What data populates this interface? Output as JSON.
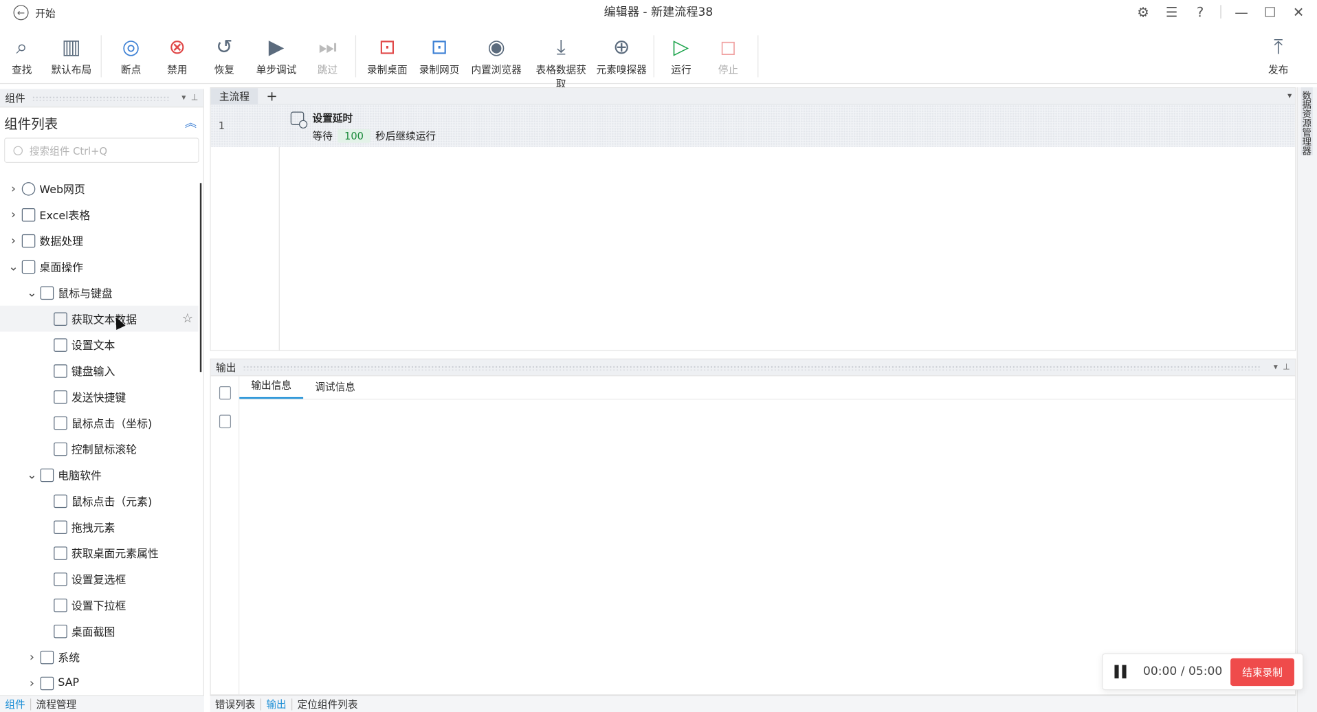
{
  "window": {
    "back_label": "开始",
    "title": "编辑器 - 新建流程38"
  },
  "toolbar": {
    "items": [
      {
        "id": "find",
        "label": "查找",
        "icon": "magnifier-icon",
        "enabled": true
      },
      {
        "id": "layout",
        "label": "默认布局",
        "icon": "layout-icon",
        "enabled": true
      },
      {
        "id": "breakpoint",
        "label": "断点",
        "icon": "breakpoint-icon",
        "enabled": true
      },
      {
        "id": "disable",
        "label": "禁用",
        "icon": "disable-icon",
        "enabled": true
      },
      {
        "id": "restore",
        "label": "恢复",
        "icon": "undo-icon",
        "enabled": true
      },
      {
        "id": "step",
        "label": "单步调试",
        "icon": "step-debug-icon",
        "enabled": true
      },
      {
        "id": "skip",
        "label": "跳过",
        "icon": "skip-icon",
        "enabled": false
      },
      {
        "id": "rec-desktop",
        "label": "录制桌面",
        "icon": "record-desktop-icon",
        "enabled": true
      },
      {
        "id": "rec-web",
        "label": "录制网页",
        "icon": "record-web-icon",
        "enabled": true
      },
      {
        "id": "browser",
        "label": "内置浏览器",
        "icon": "compass-icon",
        "enabled": true
      },
      {
        "id": "table",
        "label": "表格数据获取",
        "icon": "download-table-icon",
        "enabled": true
      },
      {
        "id": "sniffer",
        "label": "元素嗅探器",
        "icon": "target-icon",
        "enabled": true
      },
      {
        "id": "run",
        "label": "运行",
        "icon": "play-icon",
        "enabled": true
      },
      {
        "id": "stop",
        "label": "停止",
        "icon": "stop-icon",
        "enabled": false
      },
      {
        "id": "publish",
        "label": "发布",
        "icon": "publish-icon",
        "enabled": true
      }
    ]
  },
  "left_panel": {
    "header": "组件",
    "title": "组件列表",
    "search_placeholder": "搜索组件 Ctrl+Q",
    "tree": [
      {
        "label": "Web网页",
        "level": 0,
        "expanded": false
      },
      {
        "label": "Excel表格",
        "level": 0,
        "expanded": false
      },
      {
        "label": "数据处理",
        "level": 0,
        "expanded": false
      },
      {
        "label": "桌面操作",
        "level": 0,
        "expanded": true
      },
      {
        "label": "鼠标与键盘",
        "level": 1,
        "expanded": true
      },
      {
        "label": "获取文本数据",
        "level": 2
      },
      {
        "label": "设置文本",
        "level": 2
      },
      {
        "label": "键盘输入",
        "level": 2
      },
      {
        "label": "发送快捷键",
        "level": 2
      },
      {
        "label": "鼠标点击（坐标)",
        "level": 2
      },
      {
        "label": "控制鼠标滚轮",
        "level": 2
      },
      {
        "label": "电脑软件",
        "level": 1,
        "expanded": true
      },
      {
        "label": "鼠标点击（元素)",
        "level": 2
      },
      {
        "label": "拖拽元素",
        "level": 2
      },
      {
        "label": "获取桌面元素属性",
        "level": 2
      },
      {
        "label": "设置复选框",
        "level": 2
      },
      {
        "label": "设置下拉框",
        "level": 2
      },
      {
        "label": "桌面截图",
        "level": 2
      },
      {
        "label": "系统",
        "level": 1,
        "expanded": false
      },
      {
        "label": "SAP",
        "level": 1,
        "expanded": false
      }
    ],
    "bottom_tabs": [
      "组件",
      "流程管理"
    ]
  },
  "editor": {
    "tab": "主流程",
    "rows": [
      {
        "line": "1",
        "name": "设置延时",
        "prefix": "等待",
        "value": "100",
        "suffix": "秒后继续运行"
      }
    ]
  },
  "right_rail": {
    "label": "数据资源管理器"
  },
  "output": {
    "header": "输出",
    "tabs": [
      "输出信息",
      "调试信息"
    ],
    "bottom_tabs": [
      "错误列表",
      "输出",
      "定位组件列表"
    ]
  },
  "recorder": {
    "time": "00:00 / 05:00",
    "stop_label": "结束录制"
  },
  "colors": {
    "accent": "#1e8fd6",
    "danger": "#ef4b4b",
    "value_green": "#1a8a3a"
  }
}
